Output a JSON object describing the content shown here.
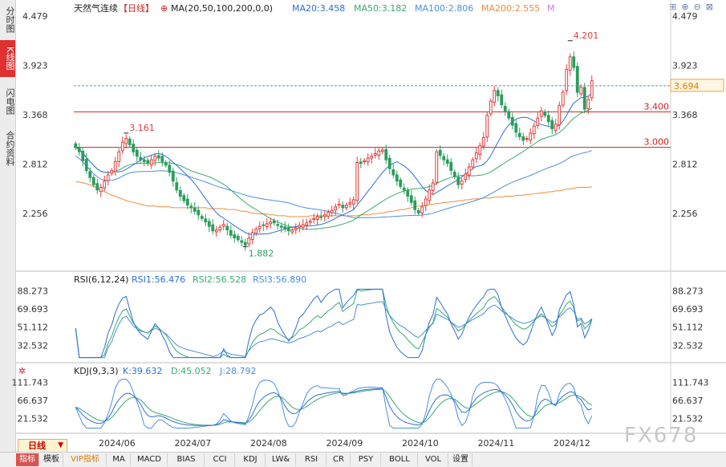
{
  "sidebar": {
    "items": [
      {
        "label": "分时图",
        "active": false
      },
      {
        "label": "K线图",
        "active": true
      },
      {
        "label": "闪电图",
        "active": false
      },
      {
        "label": "合约资料",
        "active": false
      }
    ]
  },
  "header": {
    "instrument": "天然气连续",
    "period_tag": "【日线】",
    "ma_label": "MA(20,50,100,200,0,0)",
    "ma20": "MA20:3.458",
    "ma50": "MA50:3.182",
    "ma100": "MA100:2.806",
    "ma200": "MA200:2.555",
    "m_label": "M"
  },
  "bottom": {
    "period_button": "日线",
    "tabs": [
      {
        "label": "指标",
        "active": true
      },
      {
        "label": "模板"
      },
      {
        "label": "VIP指标",
        "vip": true
      },
      {
        "label": "MA"
      },
      {
        "label": "MACD"
      },
      {
        "label": "BIAS"
      },
      {
        "label": "CCI"
      },
      {
        "label": "KDJ"
      },
      {
        "label": "LW&"
      },
      {
        "label": "RSI"
      },
      {
        "label": "CR"
      },
      {
        "label": "PSY"
      },
      {
        "label": "BOLL"
      },
      {
        "label": "VOL"
      },
      {
        "label": "设置"
      }
    ]
  },
  "watermark": "FX678",
  "chart_data": {
    "type": "candlestick",
    "price_ticks": [
      "4.479",
      "3.923",
      "3.368",
      "2.812",
      "2.256"
    ],
    "price_range": [
      1.75,
      4.479
    ],
    "current_price": "3.694",
    "hlines": [
      {
        "label": "3.400",
        "value": 3.4
      },
      {
        "label": "3.000",
        "value": 3.0
      }
    ],
    "annotations": [
      {
        "label": "4.201",
        "value": 4.201,
        "kind": "high"
      },
      {
        "label": "3.161",
        "value": 3.161,
        "kind": "high"
      },
      {
        "label": "1.882",
        "value": 1.882,
        "kind": "low"
      }
    ],
    "x_labels": [
      "2024/06",
      "2024/07",
      "2024/08",
      "2024/09",
      "2024/10",
      "2024/11",
      "2024/12"
    ],
    "colors": {
      "up": "#e23c3c",
      "down": "#2a9d5c",
      "ma20": "#2d6fd6",
      "ma50": "#3aaa6e",
      "ma100": "#4a8fe0",
      "ma200": "#f08c3c",
      "hline": "#d02020"
    },
    "closes": [
      3.0,
      2.95,
      2.85,
      2.74,
      2.66,
      2.58,
      2.52,
      2.55,
      2.62,
      2.69,
      2.74,
      2.84,
      2.95,
      3.06,
      3.1,
      3.03,
      2.95,
      2.9,
      2.86,
      2.84,
      2.82,
      2.86,
      2.9,
      2.88,
      2.84,
      2.8,
      2.72,
      2.62,
      2.52,
      2.45,
      2.4,
      2.35,
      2.32,
      2.28,
      2.24,
      2.2,
      2.16,
      2.11,
      2.06,
      2.07,
      2.1,
      2.13,
      2.07,
      2.01,
      1.98,
      1.96,
      1.93,
      1.9,
      1.98,
      2.04,
      2.08,
      2.11,
      2.12,
      2.14,
      2.16,
      2.15,
      2.12,
      2.1,
      2.08,
      2.06,
      2.07,
      2.09,
      2.12,
      2.13,
      2.15,
      2.17,
      2.2,
      2.22,
      2.21,
      2.24,
      2.27,
      2.29,
      2.33,
      2.36,
      2.32,
      2.35,
      2.38,
      2.41,
      2.83,
      2.82,
      2.85,
      2.88,
      2.9,
      2.93,
      2.96,
      2.97,
      2.86,
      2.76,
      2.69,
      2.62,
      2.56,
      2.52,
      2.45,
      2.38,
      2.3,
      2.26,
      2.33,
      2.42,
      2.52,
      2.6,
      2.95,
      2.91,
      2.86,
      2.82,
      2.74,
      2.67,
      2.58,
      2.62,
      2.7,
      2.78,
      2.86,
      2.94,
      3.02,
      3.11,
      3.36,
      3.52,
      3.64,
      3.58,
      3.48,
      3.41,
      3.33,
      3.25,
      3.17,
      3.12,
      3.08,
      3.1,
      3.16,
      3.24,
      3.33,
      3.41,
      3.36,
      3.29,
      3.21,
      3.26,
      3.47,
      3.62,
      3.88,
      4.02,
      3.9,
      3.62,
      3.68,
      3.43,
      3.54,
      3.75
    ],
    "ma200": [
      2.61,
      2.61,
      2.6,
      2.59,
      2.58,
      2.56,
      2.54,
      2.52,
      2.5,
      2.48,
      2.46,
      2.45,
      2.43,
      2.42,
      2.4,
      2.39,
      2.38,
      2.37,
      2.36,
      2.35,
      2.34,
      2.34,
      2.34,
      2.33,
      2.33,
      2.33,
      2.33,
      2.32,
      2.32,
      2.32,
      2.32,
      2.32,
      2.32,
      2.32,
      2.32,
      2.32,
      2.32,
      2.31,
      2.31,
      2.31,
      2.31,
      2.31,
      2.3,
      2.3,
      2.3,
      2.29,
      2.28,
      2.28,
      2.27,
      2.26,
      2.26,
      2.25,
      2.25,
      2.25,
      2.24,
      2.24,
      2.23,
      2.23,
      2.23,
      2.22,
      2.22,
      2.22,
      2.22,
      2.22,
      2.22,
      2.23,
      2.23,
      2.23,
      2.23,
      2.23,
      2.23,
      2.23,
      2.23,
      2.23,
      2.23,
      2.23,
      2.23,
      2.23,
      2.23,
      2.24,
      2.24,
      2.24,
      2.25,
      2.25,
      2.26,
      2.26,
      2.27,
      2.28,
      2.28,
      2.29,
      2.3,
      2.3,
      2.31,
      2.32,
      2.33,
      2.34,
      2.34,
      2.35,
      2.36,
      2.36,
      2.37,
      2.37,
      2.38,
      2.38,
      2.39,
      2.39,
      2.4,
      2.4,
      2.41,
      2.41,
      2.42,
      2.42,
      2.42,
      2.43,
      2.43,
      2.43,
      2.44,
      2.44,
      2.44,
      2.45,
      2.45,
      2.45,
      2.46,
      2.46,
      2.46,
      2.47,
      2.47,
      2.48,
      2.48,
      2.49,
      2.49,
      2.5,
      2.5,
      2.51,
      2.51,
      2.52,
      2.53,
      2.53,
      2.54,
      2.55,
      2.55,
      2.55,
      2.55,
      2.555
    ]
  },
  "rsi": {
    "label": "RSI(6,12,24)",
    "rsi1": "RSI1:56.476",
    "rsi2": "RSI2:56.528",
    "rsi3": "RSI3:56.890",
    "ticks": [
      "88.273",
      "69.693",
      "51.112",
      "32.532"
    ],
    "range": [
      18,
      92
    ]
  },
  "kdj": {
    "label": "KDJ(9,3,3)",
    "k": "K:39.632",
    "d": "D:45.052",
    "j": "J:28.792",
    "ticks": [
      "111.743",
      "66.637",
      "21.532"
    ],
    "range": [
      -5,
      125
    ]
  }
}
